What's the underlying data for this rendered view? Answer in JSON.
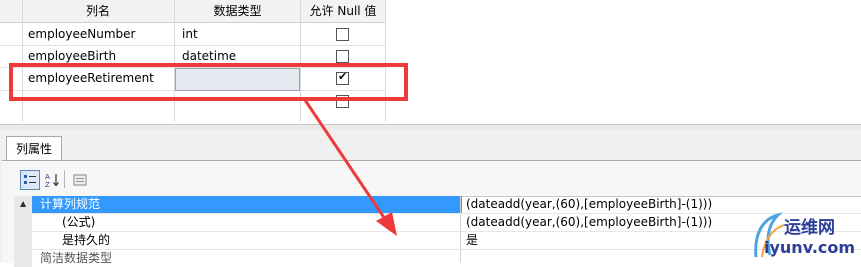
{
  "grid": {
    "columns": [
      "列名",
      "数据类型",
      "允许 Null 值"
    ],
    "rows": [
      {
        "name": "employeeNumber",
        "type": "int",
        "allow_null": false
      },
      {
        "name": "employeeBirth",
        "type": "datetime",
        "allow_null": false
      },
      {
        "name": "employeeRetirement",
        "type": "",
        "allow_null": true
      },
      {
        "name": "",
        "type": "",
        "allow_null": false
      }
    ]
  },
  "properties_panel": {
    "tab_label": "列属性",
    "toolbar": {
      "categorized_icon": "categorized-icon",
      "alphabetical_icon": "sort-az-icon",
      "property_pages_icon": "property-pages-icon"
    },
    "rows": [
      {
        "name": "计算列规范",
        "value": "(dateadd(year,(60),[employeeBirth]-(1)))",
        "selected": true,
        "expander": "▲"
      },
      {
        "name": "(公式)",
        "value": "(dateadd(year,(60),[employeeBirth]-(1)))"
      },
      {
        "name": "是持久的",
        "value": "是"
      },
      {
        "name": "简洁数据类型",
        "value": ""
      }
    ]
  },
  "annotation": {
    "color": "#ee3a3a"
  },
  "watermark": {
    "brand": "运维网",
    "domain": "iyunv.com"
  },
  "colors": {
    "selection": "#3399ff",
    "header_bg": "#f2f2f2"
  }
}
